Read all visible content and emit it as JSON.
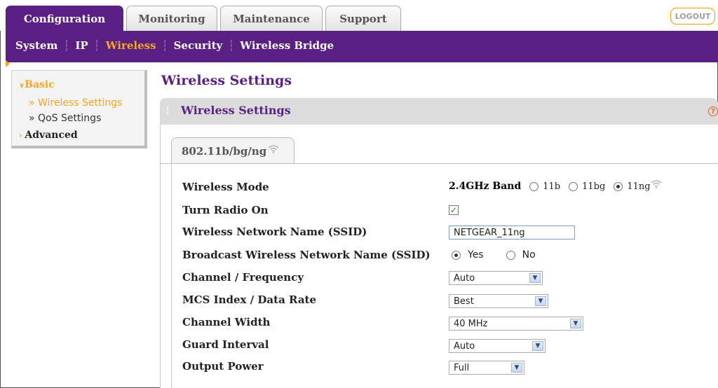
{
  "top_tabs": [
    {
      "label": "Configuration",
      "active": true
    },
    {
      "label": "Monitoring",
      "active": false
    },
    {
      "label": "Maintenance",
      "active": false
    },
    {
      "label": "Support",
      "active": false
    }
  ],
  "logout_label": "LOGOUT",
  "sub_nav": [
    {
      "label": "System",
      "active": false
    },
    {
      "label": "IP",
      "active": false
    },
    {
      "label": "Wireless",
      "active": true
    },
    {
      "label": "Security",
      "active": false
    },
    {
      "label": "Wireless Bridge",
      "active": false
    }
  ],
  "sidebar": {
    "basic_label": "Basic",
    "items": [
      {
        "label": "» Wireless Settings",
        "active": true
      },
      {
        "label": "» QoS Settings",
        "active": false
      }
    ],
    "advanced_label": "Advanced"
  },
  "page_title": "Wireless Settings",
  "section_title": "Wireless Settings",
  "help_icon": "?",
  "subtab_label": "802.11b/bg/ng",
  "form": {
    "wireless_mode_label": "Wireless Mode",
    "band_label": "2.4GHz Band",
    "mode_options": [
      {
        "label": "11b",
        "selected": false
      },
      {
        "label": "11bg",
        "selected": false
      },
      {
        "label": "11ng",
        "selected": true
      }
    ],
    "radio_on_label": "Turn Radio On",
    "radio_on_checked": true,
    "ssid_label": "Wireless Network Name (SSID)",
    "ssid_value": "NETGEAR_11ng",
    "broadcast_label": "Broadcast Wireless Network Name (SSID)",
    "broadcast_yes": "Yes",
    "broadcast_no": "No",
    "broadcast_selected": "Yes",
    "channel_label": "Channel / Frequency",
    "channel_value": "Auto",
    "mcs_label": "MCS Index / Data Rate",
    "mcs_value": "Best",
    "width_label": "Channel Width",
    "width_value": "40 MHz",
    "guard_label": "Guard Interval",
    "guard_value": "Auto",
    "power_label": "Output Power",
    "power_value": "Full"
  },
  "colors": {
    "brand_purple": "#5a1f82",
    "accent_orange": "#f5a623"
  }
}
